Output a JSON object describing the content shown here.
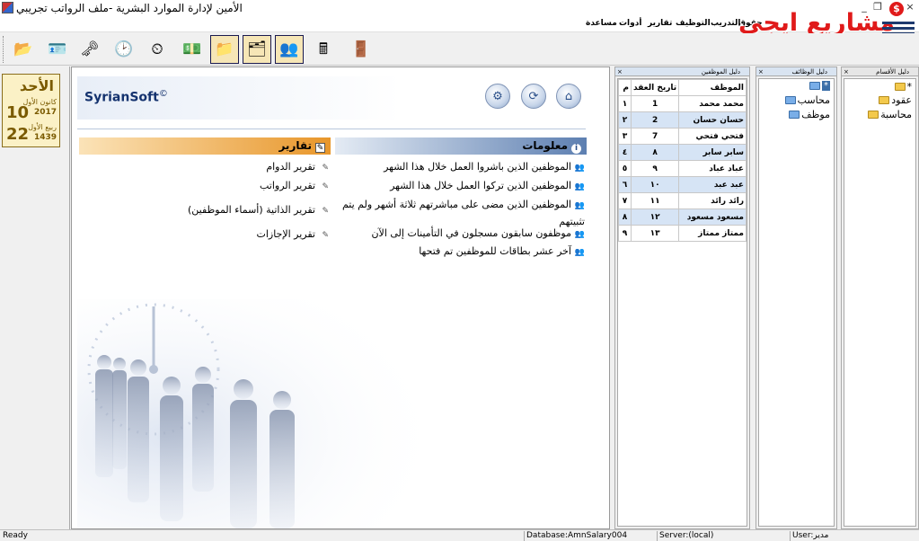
{
  "window": {
    "title": "الأمين لإدارة الموارد البشرية -ملف الرواتب تجريبي",
    "minimize": "_",
    "maximize": "❐",
    "close": "×"
  },
  "menu": [
    "مساعدة",
    "أدوات",
    "تقارير",
    "التوظيف",
    "التدريب",
    "حقوق"
  ],
  "logo": {
    "text": "مشاريع ايجي",
    "coin": "$"
  },
  "toolbar": {
    "buttons": [
      {
        "icon": "open-folder-icon",
        "glyph": "📂",
        "selected": false
      },
      {
        "icon": "employee-card-icon",
        "glyph": "🪪",
        "selected": false
      },
      {
        "icon": "add-key-icon",
        "glyph": "🗝",
        "selected": false
      },
      {
        "icon": "clock-pin-icon",
        "glyph": "🕑",
        "selected": false
      },
      {
        "icon": "attendance-clock-icon",
        "glyph": "⏲",
        "selected": false
      },
      {
        "icon": "money-stack-icon",
        "glyph": "💵",
        "selected": false
      },
      {
        "icon": "salary-folder-icon",
        "glyph": "📁",
        "selected": true
      },
      {
        "icon": "clock-folder-icon",
        "glyph": "🗂",
        "selected": true
      },
      {
        "icon": "people-folder-icon",
        "glyph": "👥",
        "selected": true
      },
      {
        "icon": "calculator-icon",
        "glyph": "🖩",
        "selected": false
      },
      {
        "icon": "exit-door-icon",
        "glyph": "🚪",
        "selected": false
      }
    ]
  },
  "calendar": {
    "day_name": "الأحد",
    "greg_day": "10",
    "greg_month": "كانون الأول",
    "greg_year": "2017",
    "hijri_day": "22",
    "hijri_month": "ربيع الأول",
    "hijri_year": "1439"
  },
  "main": {
    "brand": "SyrianSoft",
    "brand_mark": "©",
    "info": {
      "title": "معلومات",
      "items": [
        "الموظفين الذين باشروا العمل خلال هذا الشهر",
        "الموظفين الذين تركوا العمل خلال هذا الشهر",
        "الموظفين الذين مضى على مباشرتهم ثلاثة أشهر ولم يتم تثبيتهم",
        "موظفون سابقون مسجلون في التأمينات إلى الآن",
        "آخر عشر بطاقات للموظفين تم فتحها"
      ]
    },
    "reports": {
      "title": "تقارير",
      "items": [
        "تقرير الدوام",
        "تقرير الرواتب",
        "تقرير الذاتية (أسماء الموظفين)",
        "تقرير الإجازات"
      ]
    }
  },
  "employees_panel": {
    "title": "دليل الموظفين",
    "columns": [
      "م",
      "تاريخ العقد",
      "الموظف"
    ],
    "rows": [
      [
        "١",
        "1",
        "محمد محمد"
      ],
      [
        "٢",
        "2",
        "حسان حسان"
      ],
      [
        "٣",
        "7",
        "فتحي فتحي"
      ],
      [
        "٤",
        "٨",
        "سابر سابر"
      ],
      [
        "٥",
        "٩",
        "عباد عباد"
      ],
      [
        "٦",
        "١٠",
        "عبد عبد"
      ],
      [
        "٧",
        "١١",
        "رائد رائد"
      ],
      [
        "٨",
        "١٢",
        "مسعود مسعود"
      ],
      [
        "٩",
        "١٣",
        "ممتاز ممتاز"
      ]
    ]
  },
  "jobs_panel": {
    "title": "دليل الوظائف",
    "nodes": [
      "*",
      "محاسب",
      "موظف"
    ]
  },
  "departments_panel": {
    "title": "دليل الأقسام",
    "nodes": [
      "*",
      "عقود",
      "محاسبة"
    ]
  },
  "status": {
    "left": "Ready",
    "database": "Database:AmnSalary004",
    "server": "Server:(local)",
    "user": "User:مدير"
  }
}
